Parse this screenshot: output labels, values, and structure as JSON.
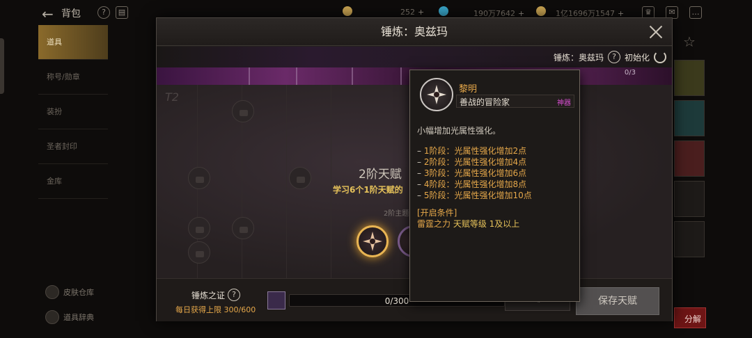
{
  "hud": {
    "bag_title": "背包",
    "currency": [
      {
        "value": "252",
        "color": "#c9a452"
      },
      {
        "value": "190万7642",
        "color": "#39a6c9"
      },
      {
        "value": "1亿1696万1547",
        "color": "#c9a452"
      }
    ],
    "plus": "+",
    "menu": [
      "道具",
      "称号/勋章",
      "装扮",
      "圣者封印",
      "金库"
    ],
    "bottom_links": [
      "皮肤仓库",
      "道具辞典"
    ],
    "fenjie": "分解"
  },
  "modal": {
    "title": "锤炼：奥兹玛",
    "sub_label": "锤炼：奥兹玛",
    "reset_label": "初始化",
    "banner_count": "0/3",
    "tier_mark": "T2",
    "tier_title": "2阶天赋",
    "tier_desc": "学习6个1阶天赋的",
    "tier_note": "2阶主题",
    "footer": {
      "proof_label": "锤炼之证",
      "daily_limit": "每日获得上限 300/600",
      "progress_text": "0/300",
      "progress_fraction": 0,
      "save_label": "保存天赋"
    }
  },
  "tooltip": {
    "name": "黎明",
    "subtitle": "善战的冒险家",
    "tag": "神器",
    "description": "小幅增加光属性强化。",
    "stages": [
      {
        "stage": "1阶段：",
        "text": "光属性强化增加",
        "value": "2",
        "unit": "点"
      },
      {
        "stage": "2阶段：",
        "text": "光属性强化增加",
        "value": "4",
        "unit": "点"
      },
      {
        "stage": "3阶段：",
        "text": "光属性强化增加",
        "value": "6",
        "unit": "点"
      },
      {
        "stage": "4阶段：",
        "text": "光属性强化增加",
        "value": "8",
        "unit": "点"
      },
      {
        "stage": "5阶段：",
        "text": "光属性强化增加",
        "value": "10",
        "unit": "点"
      }
    ],
    "condition_title": "[开启条件]",
    "condition_skill": "雷霆之力",
    "condition_text": " 天赋等级 1及以上"
  }
}
